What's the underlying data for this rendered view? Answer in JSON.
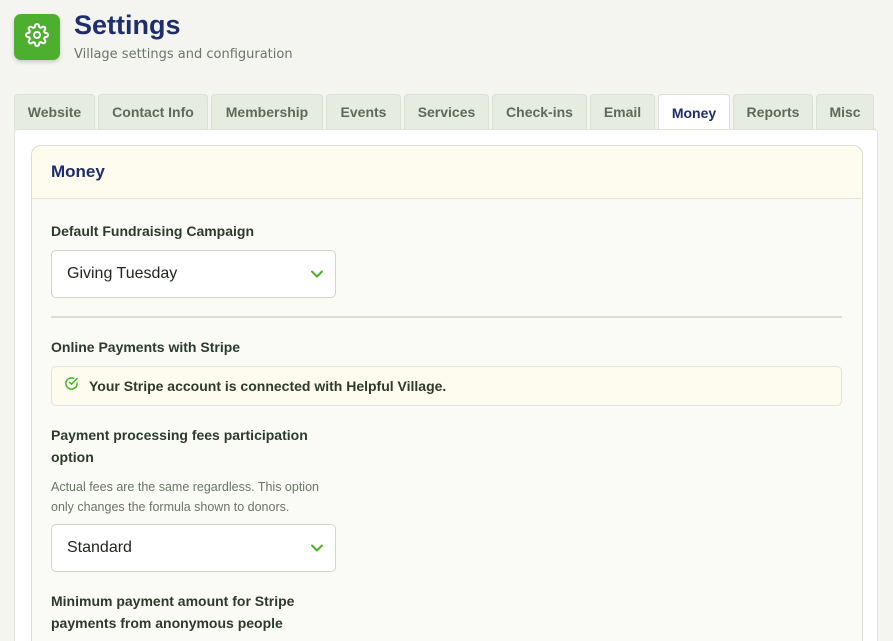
{
  "header": {
    "title": "Settings",
    "subtitle": "Village settings and configuration",
    "icon": "gear-icon",
    "icon_color": "#4caf2e"
  },
  "tabs": [
    {
      "label": "Website"
    },
    {
      "label": "Contact Info"
    },
    {
      "label": "Membership"
    },
    {
      "label": "Events"
    },
    {
      "label": "Services"
    },
    {
      "label": "Check-ins"
    },
    {
      "label": "Email"
    },
    {
      "label": "Money",
      "active": true
    },
    {
      "label": "Reports"
    },
    {
      "label": "Misc"
    }
  ],
  "section": {
    "title": "Money",
    "fundraising": {
      "label": "Default Fundraising Campaign",
      "value": "Giving Tuesday"
    },
    "stripe": {
      "label": "Online Payments with Stripe",
      "status_text": "Your Stripe account is connected with Helpful Village.",
      "status_icon": "check-circle-icon"
    },
    "fees": {
      "label_line1": "Payment processing fees participation",
      "label_line2": "option",
      "help_line1": "Actual fees are the same regardless. This option",
      "help_line2": "only changes the formula shown to donors.",
      "value": "Standard"
    },
    "minimum": {
      "label_line1": "Minimum payment amount for Stripe",
      "label_line2": "payments from anonymous people"
    }
  },
  "colors": {
    "accent": "#4caf2e",
    "title": "#1f2d6b"
  }
}
